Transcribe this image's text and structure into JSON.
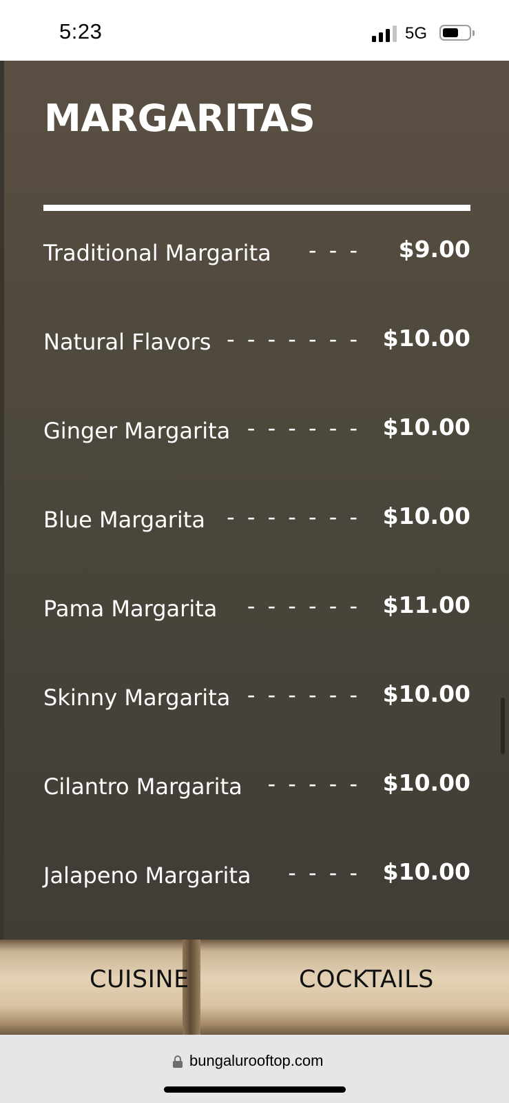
{
  "status_bar": {
    "time": "5:23",
    "network": "5G",
    "signal_icon": "cellular-signal-icon",
    "battery_icon": "battery-icon"
  },
  "menu": {
    "title": "MARGARITAS",
    "items": [
      {
        "name": "Traditional Margarita",
        "dashes": "- - -",
        "price": "$9.00"
      },
      {
        "name": "Natural Flavors",
        "dashes": "- - - - - - -",
        "price": "$10.00"
      },
      {
        "name": "Ginger Margarita",
        "dashes": "- - - - - -",
        "price": "$10.00"
      },
      {
        "name": "Blue Margarita",
        "dashes": "- - - - - - -",
        "price": "$10.00"
      },
      {
        "name": "Pama Margarita",
        "dashes": "- - - - - -",
        "price": "$11.00"
      },
      {
        "name": "Skinny Margarita",
        "dashes": "- - - - - -",
        "price": "$10.00"
      },
      {
        "name": "Cilantro Margarita",
        "dashes": "- - - - -",
        "price": "$10.00"
      },
      {
        "name": "Jalapeno Margarita",
        "dashes": "- - - -",
        "price": "$10.00"
      }
    ]
  },
  "nav": {
    "cuisine": "CUISINE",
    "cocktails": "COCKTAILS"
  },
  "browser": {
    "url": "bungalurooftop.com",
    "lock_icon": "lock-icon"
  }
}
